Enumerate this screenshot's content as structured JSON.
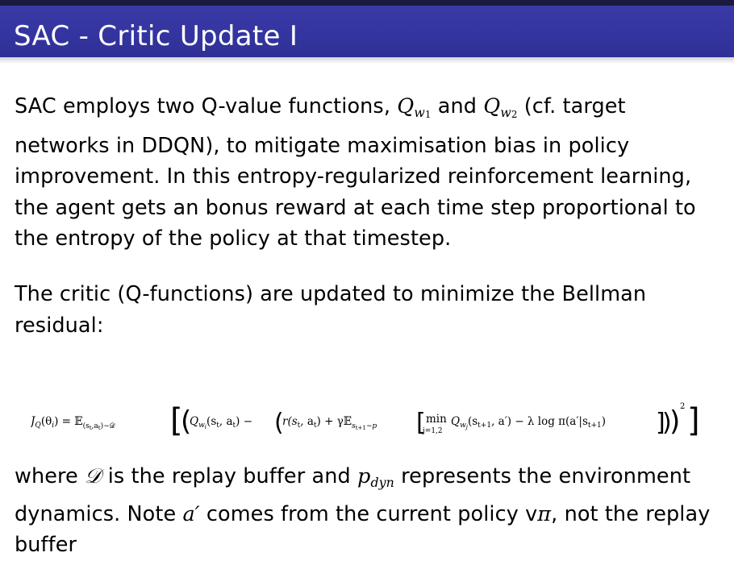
{
  "slide": {
    "title": "SAC - Critic Update I"
  },
  "paragraph1": {
    "text_before": "SAC employs two Q-value functions, ",
    "q_symbol": "Q",
    "q1_sub": "w",
    "q1_subsub": "1",
    "and": " and ",
    "q2_sub": "w",
    "q2_subsub": "2",
    "text_after": " (cf. target networks in DDQN), to mitigate maximisation bias in policy improvement. In this entropy-regularized reinforcement learning, the agent gets an bonus reward at each time step proportional to the entropy of the policy at that timestep."
  },
  "paragraph2": {
    "text": "The critic (Q-functions) are updated to minimize the Bellman residual:"
  },
  "formula": {
    "lhs": "J",
    "lhs_sub": "Q",
    "lhs_arg": "(θ",
    "lhs_arg_sub": "i",
    "lhs_close": ") = 𝔼",
    "expect_sub": "(s",
    "expect_sub_t": "t",
    "expect_sub_mid": ",a",
    "expect_sub_t2": "t",
    "expect_sub_end": ")∼𝒟",
    "q_term": "Q",
    "q_term_sub": "w",
    "q_term_subsub": "i",
    "q_args": "(s",
    "q_args_t": "t",
    "q_args_mid": ", a",
    "q_args_t2": "t",
    "q_args_end": ") −",
    "r_term": "r(s",
    "r_t": "t",
    "r_mid": ", a",
    "r_t2": "t",
    "r_end": ") + γ𝔼",
    "e2_sub": "s",
    "e2_sub_t": "t+1",
    "e2_sub_end": "∼p",
    "min": "min",
    "min_sub": "j=1,2",
    "q2": "Q",
    "q2_sub": "w",
    "q2_subsub": "j",
    "q2_args": "(s",
    "q2_args_t": "t+1",
    "q2_args_end": ", a′) − λ log π(a′|s",
    "pi_t": "t+1",
    "pi_end": ")",
    "exponent": "2"
  },
  "paragraph3": {
    "text_where": "where ",
    "d_symbol": "𝒟",
    "text_replay": " is the replay buffer and ",
    "p_symbol": "p",
    "p_sub": "dyn",
    "text_represents": " represents the environment dynamics. Note ",
    "a_prime": "a′",
    "text_comes": " comes from the current policy v",
    "pi_symbol": "π",
    "text_end": ", not the replay buffer"
  }
}
